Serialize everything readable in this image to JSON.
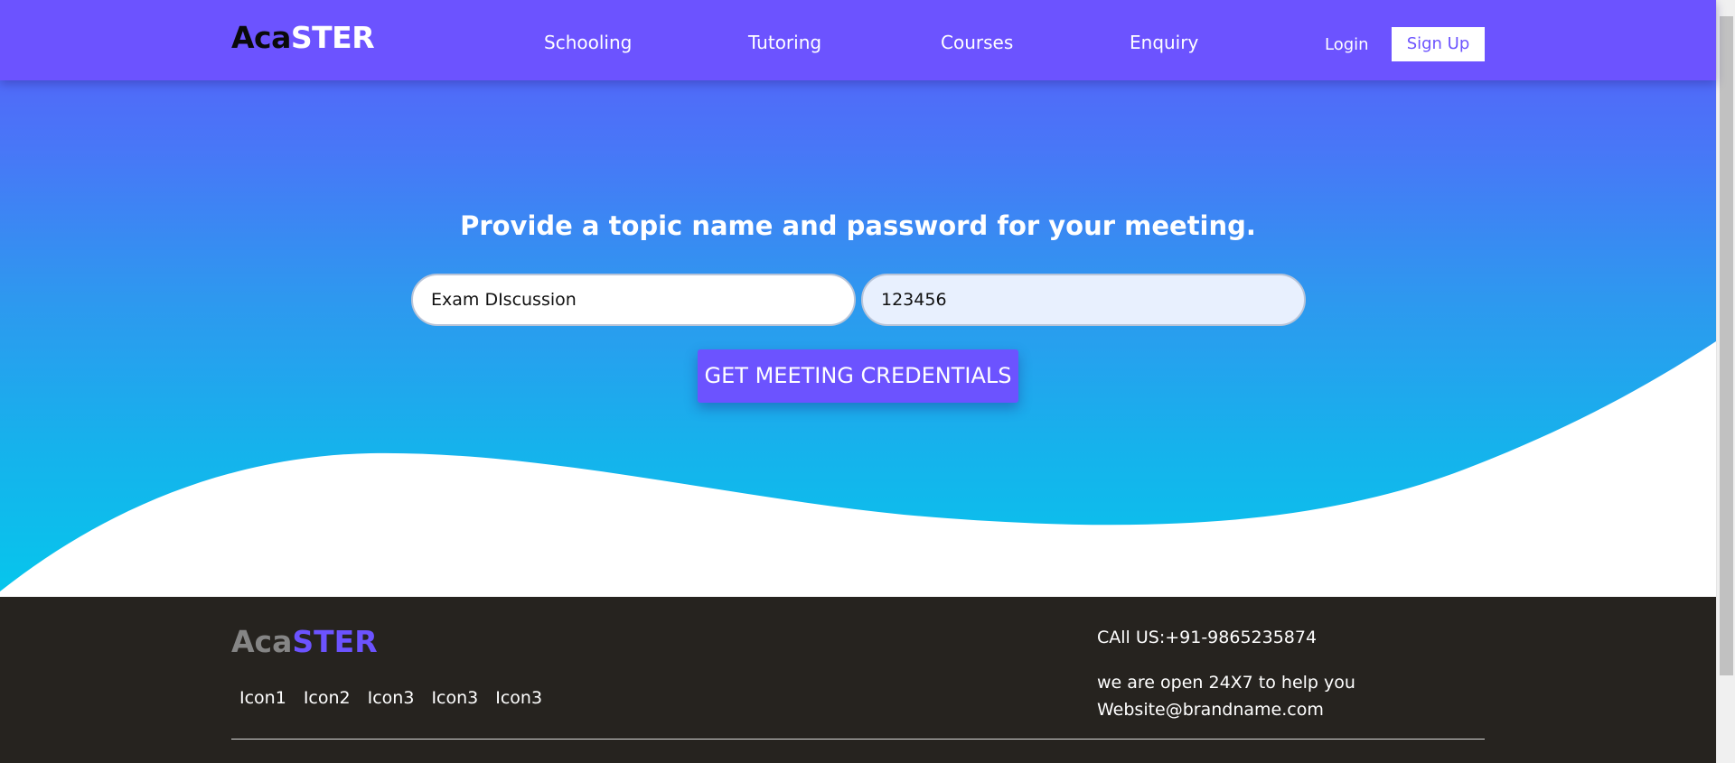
{
  "header": {
    "logo_part1": "Aca",
    "logo_part2": "STER",
    "nav": [
      "Schooling",
      "Tutoring",
      "Courses",
      "Enquiry"
    ],
    "login_label": "Login",
    "signup_label": "Sign Up"
  },
  "form": {
    "heading": "Provide a topic name and password for your meeting.",
    "topic_value": "Exam DIscussion",
    "password_value": "123456",
    "submit_label": "GET MEETING CREDENTIALS"
  },
  "footer": {
    "logo_part1": "Aca",
    "logo_part2": "STER",
    "icons": [
      "Icon1",
      "Icon2",
      "Icon3",
      "Icon3",
      "Icon3"
    ],
    "call": "CAll US:+91-9865235874",
    "hours": "we are open 24X7 to help you",
    "email": "Website@brandname.com"
  },
  "colors": {
    "accent": "#6c53ff",
    "footer_bg": "#26231f"
  }
}
